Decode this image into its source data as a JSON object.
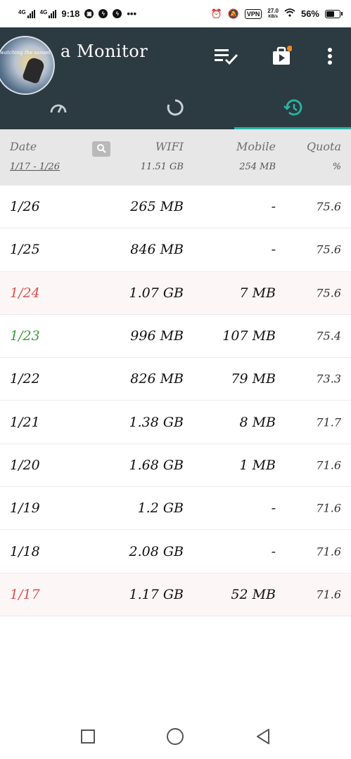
{
  "status_bar": {
    "network1": "4G",
    "network2": "4G",
    "time": "9:18",
    "vpn_label": "VPN",
    "speed_value": "27.0",
    "speed_unit": "KB/s",
    "battery": "56%"
  },
  "app": {
    "title": "a Monitor",
    "avatar_text": "watching the sunset"
  },
  "tabs": [
    {
      "icon": "speedometer-icon"
    },
    {
      "icon": "circle-progress-icon"
    },
    {
      "icon": "history-icon",
      "active": true
    }
  ],
  "table": {
    "headers": {
      "date": "Date",
      "date_range": "1/17 - 1/26",
      "wifi": "WIFI",
      "wifi_total": "11.51 GB",
      "mobile": "Mobile",
      "mobile_total": "254 MB",
      "quota": "Quota",
      "quota_unit": "%"
    },
    "rows": [
      {
        "date": "1/26",
        "wifi": "265 MB",
        "mobile": "-",
        "quota": "75.6",
        "date_color": "#111111"
      },
      {
        "date": "1/25",
        "wifi": "846 MB",
        "mobile": "-",
        "quota": "75.6",
        "date_color": "#111111"
      },
      {
        "date": "1/24",
        "wifi": "1.07 GB",
        "mobile": "7 MB",
        "quota": "75.6",
        "date_color": "#d9534f"
      },
      {
        "date": "1/23",
        "wifi": "996 MB",
        "mobile": "107 MB",
        "quota": "75.4",
        "date_color": "#3c9a3c"
      },
      {
        "date": "1/22",
        "wifi": "826 MB",
        "mobile": "79 MB",
        "quota": "73.3",
        "date_color": "#111111"
      },
      {
        "date": "1/21",
        "wifi": "1.38 GB",
        "mobile": "8 MB",
        "quota": "71.7",
        "date_color": "#111111"
      },
      {
        "date": "1/20",
        "wifi": "1.68 GB",
        "mobile": "1 MB",
        "quota": "71.6",
        "date_color": "#111111"
      },
      {
        "date": "1/19",
        "wifi": "1.2 GB",
        "mobile": "-",
        "quota": "71.6",
        "date_color": "#111111"
      },
      {
        "date": "1/18",
        "wifi": "2.08 GB",
        "mobile": "-",
        "quota": "71.6",
        "date_color": "#111111"
      },
      {
        "date": "1/17",
        "wifi": "1.17 GB",
        "mobile": "52 MB",
        "quota": "71.6",
        "date_color": "#d9534f"
      }
    ]
  },
  "colors": {
    "header_bg": "#2c3a41",
    "accent": "#2bb3a3",
    "notification_dot": "#f08a24"
  }
}
